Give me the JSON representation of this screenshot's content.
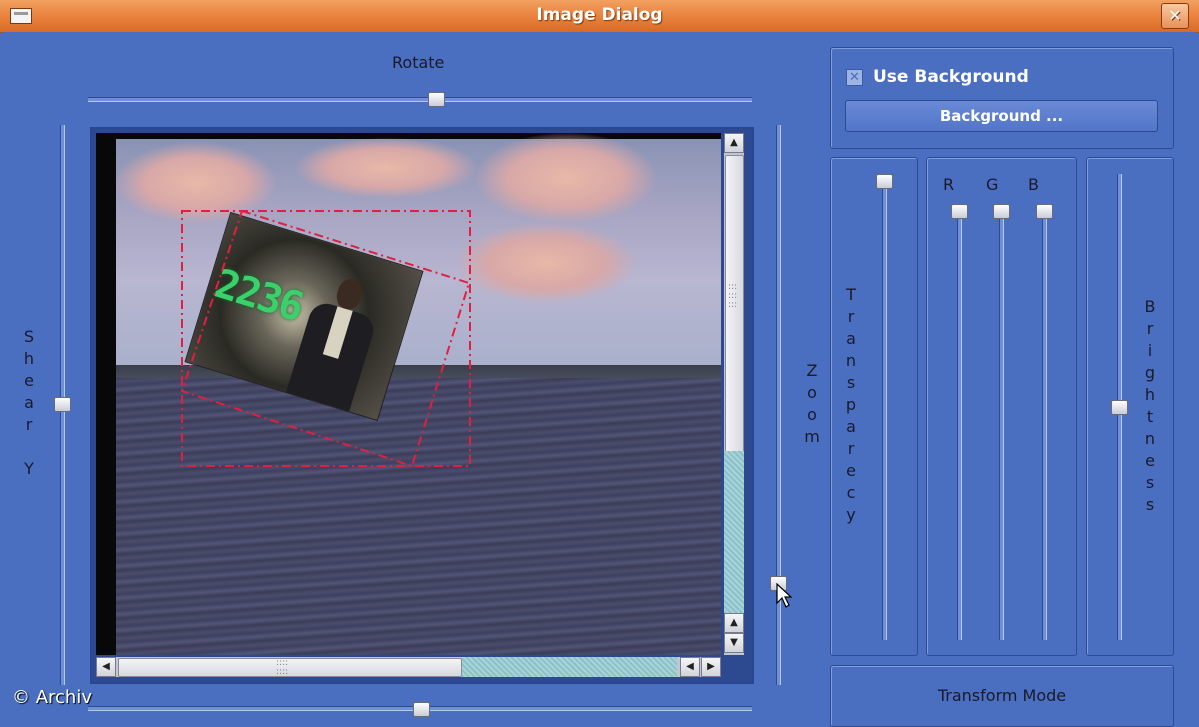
{
  "window": {
    "title": "Image Dialog",
    "close_glyph": "✕"
  },
  "sliders": {
    "rotate_label": "Rotate",
    "shear_y_letters": [
      "S",
      "h",
      "e",
      "a",
      "r",
      "",
      "Y"
    ],
    "zoom_letters": [
      "Z",
      "o",
      "o",
      "m"
    ],
    "transparency_letters": [
      "T",
      "r",
      "a",
      "n",
      "s",
      "p",
      "a",
      "r",
      "e",
      "c",
      "y"
    ],
    "brightness_letters": [
      "B",
      "r",
      "i",
      "g",
      "h",
      "t",
      "n",
      "e",
      "s",
      "s"
    ],
    "rgb_labels": [
      "R",
      "G",
      "B"
    ]
  },
  "background_options": {
    "use_background_label": "Use Background",
    "use_background_checked": true,
    "background_button_label": "Background ..."
  },
  "transform_mode": {
    "label": "Transform Mode"
  },
  "overlay": {
    "photo_number_text": "2236"
  },
  "watermark": "© Archiv",
  "icons": {
    "window_menu": "window-menu-icon",
    "close": "close-icon",
    "cursor": "mouse-pointer-icon"
  },
  "colors": {
    "titlebar": "#e8803a",
    "dialog_bg": "#4a6fc0",
    "selection_frame": "#e02040"
  }
}
